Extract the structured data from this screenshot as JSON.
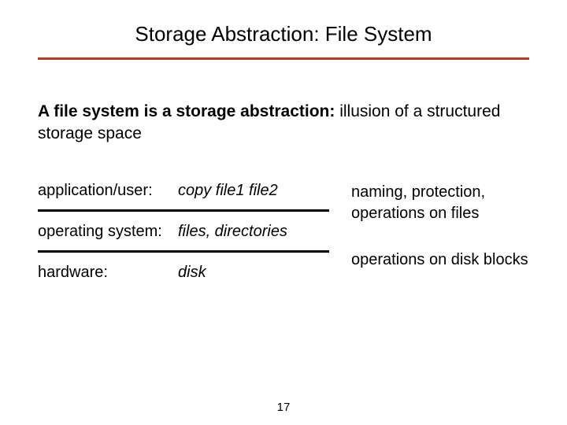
{
  "title": "Storage Abstraction: File System",
  "intro": {
    "bold": "A file system is a storage abstraction:",
    "rest": " illusion of a structured storage space"
  },
  "rows": {
    "app_label": "application/user:",
    "app_value": "copy file1 file2",
    "os_label": "operating system:",
    "os_value": "files, directories",
    "hw_label": "hardware:",
    "hw_value": "disk"
  },
  "right": {
    "note1": "naming, protection, operations on files",
    "note2": "operations on disk blocks"
  },
  "page_number": "17"
}
